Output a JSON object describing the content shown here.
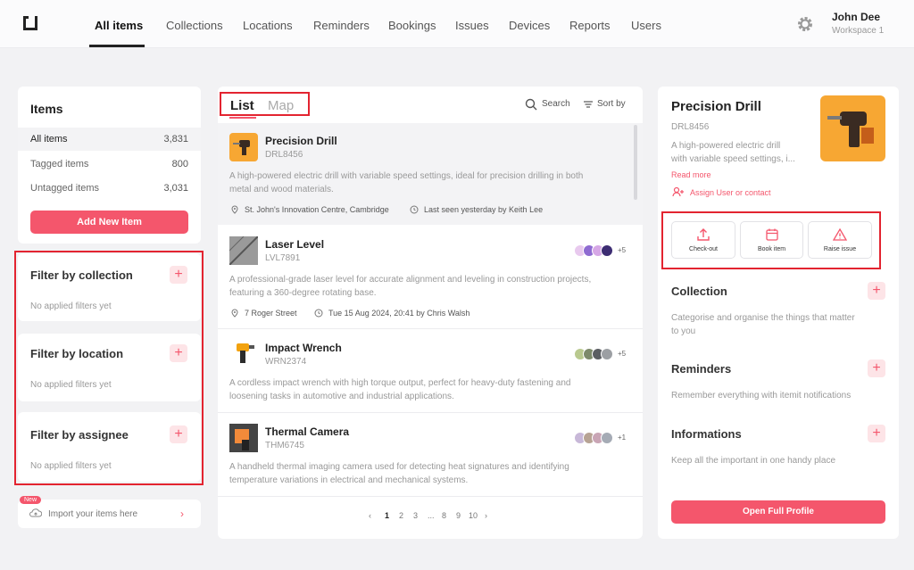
{
  "nav": {
    "items": [
      "All items",
      "Collections",
      "Locations",
      "Reminders",
      "Bookings",
      "Issues",
      "Devices",
      "Reports",
      "Users"
    ],
    "active": "All items",
    "user_name": "John Dee",
    "workspace": "Workspace 1"
  },
  "sidebar": {
    "title": "Items",
    "rows": [
      {
        "label": "All items",
        "count": "3,831"
      },
      {
        "label": "Tagged items",
        "count": "800"
      },
      {
        "label": "Untagged items",
        "count": "3,031"
      }
    ],
    "add_button": "Add New Item",
    "filters": [
      {
        "title": "Filter by collection",
        "empty": "No applied filters yet"
      },
      {
        "title": "Filter by location",
        "empty": "No applied filters yet"
      },
      {
        "title": "Filter by assignee",
        "empty": "No applied filters yet"
      }
    ],
    "import": {
      "badge": "New",
      "label": "Import your items here"
    }
  },
  "list": {
    "tabs": [
      "List",
      "Map"
    ],
    "search_label": "Search",
    "sort_label": "Sort by",
    "items": [
      {
        "name": "Precision Drill",
        "code": "DRL8456",
        "desc_lines": [
          "A high-powered electric drill with variable speed settings, ideal for precision drilling in both",
          "metal and wood materials."
        ],
        "location": "St. John's Innovation Centre, Cambridge",
        "activity": "Last seen yesterday by Keith Lee"
      },
      {
        "name": "Laser Level",
        "code": "LVL7891",
        "desc_lines": [
          "A professional-grade laser level for accurate alignment and leveling in construction projects,",
          "featuring a 360-degree rotating base."
        ],
        "location": "7 Roger Street",
        "activity": "Tue 15 Aug 2024, 20:41 by Chris Walsh",
        "avatars_more": "+5"
      },
      {
        "name": "Impact Wrench",
        "code": "WRN2374",
        "desc_lines": [
          "A cordless impact wrench with high torque output, perfect for heavy-duty fastening and",
          "loosening tasks in automotive and industrial applications."
        ],
        "avatars_more": "+5"
      },
      {
        "name": "Thermal Camera",
        "code": "THM6745",
        "desc_lines": [
          "A handheld thermal imaging camera used for detecting heat signatures and identifying",
          "temperature variations in electrical and mechanical systems."
        ],
        "avatars_more": "+1"
      }
    ],
    "pagination": [
      "‹",
      "1",
      "2",
      "3",
      "...",
      "8",
      "9",
      "10",
      "›"
    ]
  },
  "detail": {
    "title": "Precision Drill",
    "code": "DRL8456",
    "desc_lines": [
      "A high-powered electric drill",
      "with variable speed settings, i..."
    ],
    "read_more": "Read more",
    "assign": "Assign User or contact",
    "actions": [
      "Check-out",
      "Book item",
      "Raise issue"
    ],
    "sections": [
      {
        "title": "Collection",
        "desc_lines": [
          "Categorise and organise the things that matter",
          "to you"
        ]
      },
      {
        "title": "Reminders",
        "desc_lines": [
          "Remember everything with itemit notifications"
        ]
      },
      {
        "title": "Informations",
        "desc_lines": [
          "Keep all the important in one handy place"
        ]
      }
    ],
    "open_button": "Open Full Profile"
  },
  "colors": {
    "accent": "#f4566c",
    "highlight": "#e32430"
  }
}
